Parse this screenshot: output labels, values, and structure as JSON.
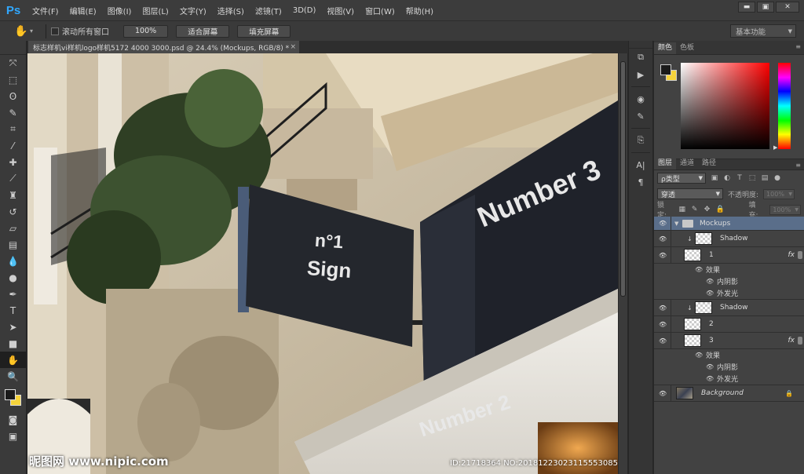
{
  "app": {
    "logo": "Ps"
  },
  "menu": [
    "文件(F)",
    "编辑(E)",
    "图像(I)",
    "图层(L)",
    "文字(Y)",
    "选择(S)",
    "滤镜(T)",
    "3D(D)",
    "视图(V)",
    "窗口(W)",
    "帮助(H)"
  ],
  "window_controls": {
    "minimize": "▬",
    "restore": "▣",
    "close": "✕"
  },
  "options": {
    "scroll_all_label": "滚动所有窗口",
    "btn_zoom": "100%",
    "btn_fit": "适合屏幕",
    "btn_fill": "填充屏幕",
    "workspace": "基本功能"
  },
  "document": {
    "tab_title": "标志样机vi样机logo样机5172 4000 3000.psd @ 24.4% (Mockups, RGB/8) *",
    "close": "×"
  },
  "canvas_text": {
    "sign1_line1": "n°1",
    "sign1_line2": "Sign",
    "sign3": "Number 3",
    "sign2": "Number 2",
    "watermark_left": "昵图网 www.nipic.com",
    "watermark_right": "ID:21718364 NO:20181223023115553085"
  },
  "color_panel": {
    "tabs": [
      "颜色",
      "色板"
    ]
  },
  "layers_panel": {
    "tabs": [
      "图层",
      "通道",
      "路径"
    ],
    "filter_kind": "ρ类型",
    "blend_mode": "穿透",
    "opacity_label": "不透明度:",
    "opacity_value": "100%",
    "lock_label": "锁定:",
    "fill_label": "填充:",
    "fill_value": "100%",
    "layers": [
      {
        "name": "Mockups"
      },
      {
        "name": "Shadow"
      },
      {
        "name": "1"
      },
      {
        "name": "Shadow"
      },
      {
        "name": "2"
      },
      {
        "name": "3"
      },
      {
        "name": "Background"
      }
    ],
    "effects_label": "效果",
    "inner_shadow": "内阴影",
    "outer_glow": "外发光",
    "fx": "fx"
  },
  "colors": {
    "foreground": "#1a1a1a",
    "background": "#f5d33b",
    "accent": "#31a8ff",
    "selection": "#5a6e8a"
  }
}
